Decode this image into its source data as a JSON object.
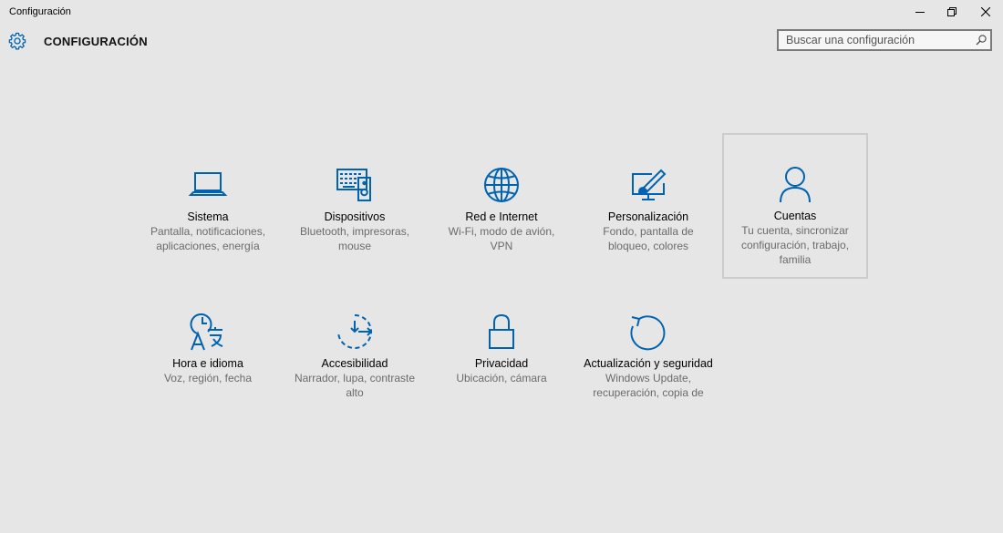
{
  "window": {
    "title": "Configuración"
  },
  "header": {
    "title": "CONFIGURACIÓN",
    "search_placeholder": "Buscar una configuración"
  },
  "accent_color": "#0063b1",
  "tiles": [
    {
      "title": "Sistema",
      "desc": "Pantalla, notificaciones, aplicaciones, energía",
      "icon": "laptop-icon",
      "selected": false
    },
    {
      "title": "Dispositivos",
      "desc": "Bluetooth, impresoras, mouse",
      "icon": "keyboard-speaker-icon",
      "selected": false
    },
    {
      "title": "Red e Internet",
      "desc": "Wi-Fi, modo de avión, VPN",
      "icon": "globe-icon",
      "selected": false
    },
    {
      "title": "Personalización",
      "desc": "Fondo, pantalla de bloqueo, colores",
      "icon": "paint-monitor-icon",
      "selected": false
    },
    {
      "title": "Cuentas",
      "desc": "Tu cuenta, sincronizar configuración, trabajo, familia",
      "icon": "person-icon",
      "selected": true
    },
    {
      "title": "Hora e idioma",
      "desc": "Voz, región, fecha",
      "icon": "time-language-icon",
      "selected": false
    },
    {
      "title": "Accesibilidad",
      "desc": "Narrador, lupa, contraste alto",
      "icon": "accessibility-timer-icon",
      "selected": false
    },
    {
      "title": "Privacidad",
      "desc": "Ubicación, cámara",
      "icon": "lock-icon",
      "selected": false
    },
    {
      "title": "Actualización y seguridad",
      "desc": "Windows Update, recuperación, copia de",
      "icon": "refresh-icon",
      "selected": false
    }
  ]
}
